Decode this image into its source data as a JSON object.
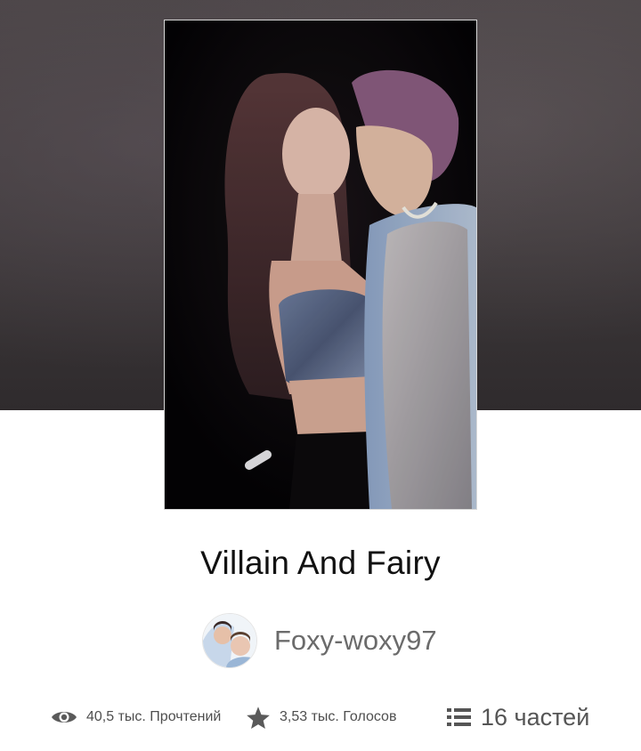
{
  "story": {
    "title": "Villain And Fairy",
    "author": "Foxy-woxy97"
  },
  "stats": {
    "reads": "40,5 тыс. Прочтений",
    "votes": "3,53 тыс. Голосов",
    "parts": "16 частей"
  },
  "icons": {
    "reads": "eye-icon",
    "votes": "star-icon",
    "parts": "list-icon"
  },
  "colors": {
    "title": "#111111",
    "author": "#6b6b6b",
    "stats": "#555555",
    "hero_background": "#413c3e"
  }
}
